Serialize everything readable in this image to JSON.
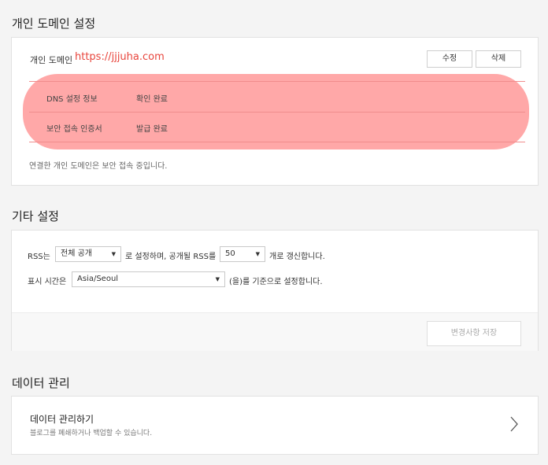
{
  "domain_section": {
    "title": "개인 도메인 설정",
    "label": "개인 도메인",
    "url": "https://jjjuha.com",
    "edit_label": "수정",
    "delete_label": "삭제",
    "rows": [
      {
        "key": "DNS 설정 정보",
        "value": "확인 완료"
      },
      {
        "key": "보안 접속 인증서",
        "value": "발급 완료"
      }
    ],
    "note": "연결한 개인 도메인은 보안 접속 중입니다."
  },
  "other_section": {
    "title": "기타 설정",
    "rss_prefix": "RSS는",
    "rss_scope": "전체 공개",
    "rss_middle": "로 설정하며, 공개될 RSS를",
    "rss_count": "50",
    "rss_suffix": "개로 갱신합니다.",
    "time_prefix": "표시 시간은",
    "timezone": "Asia/Seoul",
    "time_suffix": "(을)를 기준으로 설정합니다.",
    "save_label": "변경사항 저장"
  },
  "data_section": {
    "title": "데이터 관리",
    "item_title": "데이터 관리하기",
    "item_sub": "블로그를 폐쇄하거나 백업할 수 있습니다."
  }
}
